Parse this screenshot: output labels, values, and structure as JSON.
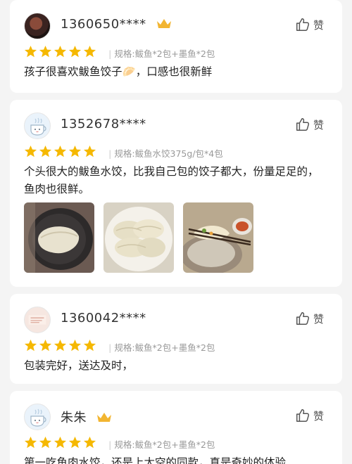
{
  "reviews": [
    {
      "username": "1360650****",
      "has_crown": true,
      "avatar": "photo-avatar",
      "like_label": "赞",
      "stars": 5,
      "spec": "规格:鲅鱼*2包+墨鱼*2包",
      "text": "孩子很喜欢鲅鱼饺子🥟，口感也很新鲜"
    },
    {
      "username": "1352678****",
      "has_crown": false,
      "avatar": "cup-avatar",
      "like_label": "赞",
      "stars": 5,
      "spec": "规格:鲅鱼水饺375g/包*4包",
      "text": "个头很大的鲅鱼水饺，比我自己包的饺子都大，份量足足的，鱼肉也很鲜。",
      "photos": [
        "dumpling-photo-pan",
        "dumpling-photo-plate",
        "dumpling-photo-chopsticks"
      ]
    },
    {
      "username": "1360042****",
      "has_crown": false,
      "avatar": "card-avatar",
      "like_label": "赞",
      "stars": 5,
      "spec": "规格:鲅鱼*2包+墨鱼*2包",
      "text": "包装完好，送达及时，"
    },
    {
      "username": "朱朱",
      "has_crown": true,
      "avatar": "cup-avatar",
      "like_label": "赞",
      "stars": 5,
      "spec": "规格:鲅鱼*2包+墨鱼*2包",
      "text": "第一吃鱼肉水饺，还是上太空的同款，真是奇妙的体验"
    }
  ],
  "colors": {
    "star": "#f5b800",
    "crown": "#f2b531",
    "spec": "#999999",
    "card": "#ffffff",
    "background": "#f4f4f4"
  }
}
